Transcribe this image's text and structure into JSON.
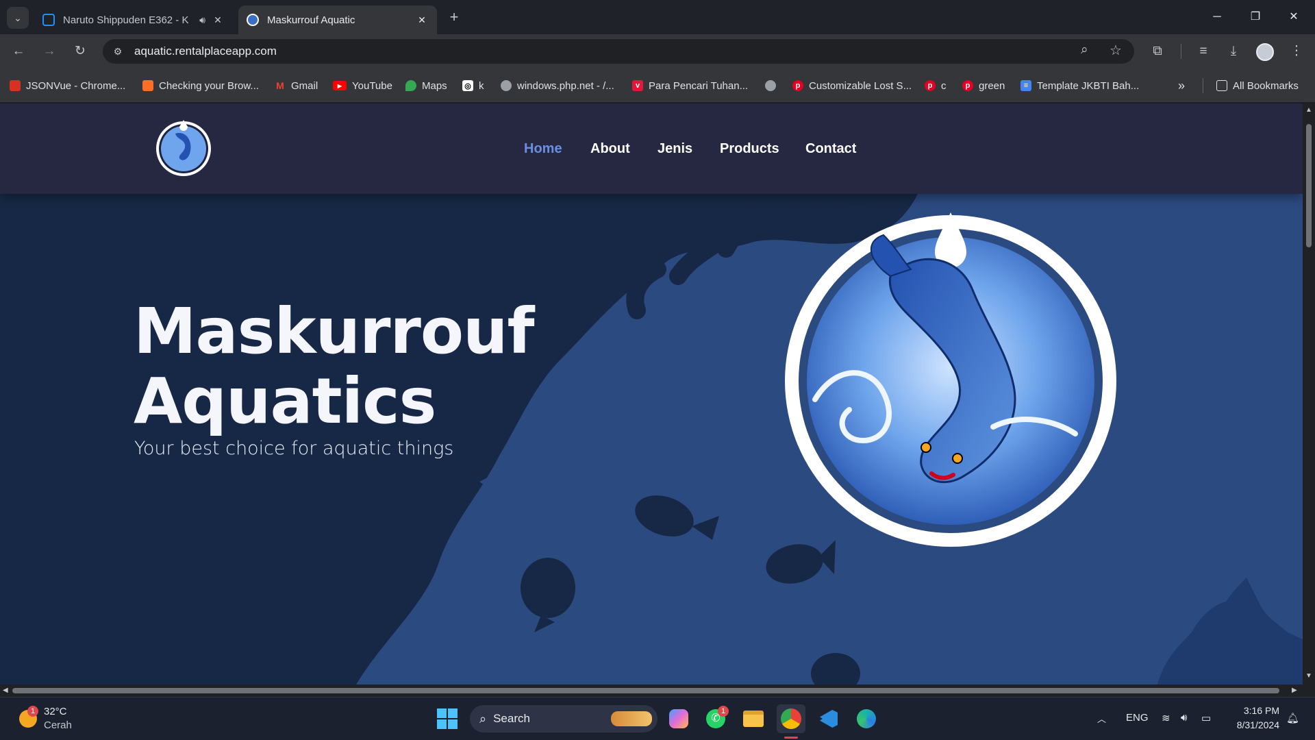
{
  "browser": {
    "tabs": [
      {
        "title": "Naruto Shippuden E362 - K",
        "active": false,
        "favicon_color": "#1e90ff"
      },
      {
        "title": "Maskurrouf Aquatic",
        "active": true,
        "favicon_color": "#3b6fc4"
      }
    ],
    "new_tab_icon": "plus-icon",
    "url": "aquatic.rentalplaceapp.com",
    "bookmarks": [
      {
        "label": "JSONVue - Chrome...",
        "color": "#d93025",
        "icon": "chrome-store-icon"
      },
      {
        "label": "Checking your Brow...",
        "color": "#fc6d26",
        "icon": "gitlab-icon"
      },
      {
        "label": "Gmail",
        "color": "#ea4335",
        "icon": "gmail-icon"
      },
      {
        "label": "YouTube",
        "color": "#ff0000",
        "icon": "youtube-icon"
      },
      {
        "label": "Maps",
        "color": "#34a853",
        "icon": "maps-icon"
      },
      {
        "label": "k",
        "color": "#ffffff",
        "icon": "openai-icon"
      },
      {
        "label": "windows.php.net - /...",
        "color": "#9aa0a6",
        "icon": "globe-icon"
      },
      {
        "label": "Para Pencari Tuhan...",
        "color": "#e4163a",
        "icon": "vidio-icon"
      },
      {
        "label": "",
        "color": "#9aa0a6",
        "icon": "globe-icon"
      },
      {
        "label": "Customizable Lost S...",
        "color": "#e60023",
        "icon": "pinterest-icon"
      },
      {
        "label": "c",
        "color": "#e60023",
        "icon": "pinterest-icon"
      },
      {
        "label": "green",
        "color": "#e60023",
        "icon": "pinterest-icon"
      },
      {
        "label": "Template JKBTI Bah...",
        "color": "#4285f4",
        "icon": "docs-icon"
      }
    ],
    "more_bookmarks": "»",
    "all_bookmarks": "All Bookmarks"
  },
  "site": {
    "nav": [
      {
        "label": "Home",
        "active": true
      },
      {
        "label": "About",
        "active": false
      },
      {
        "label": "Jenis",
        "active": false
      },
      {
        "label": "Products",
        "active": false
      },
      {
        "label": "Contact",
        "active": false
      }
    ],
    "hero": {
      "title_line1": "Maskurrouf",
      "title_line2": "Aquatics",
      "subtitle": "Your best choice for aquatic things"
    },
    "colors": {
      "header_bg": "#252840",
      "hero_bg": "#2b4a80",
      "silhouette": "#172846",
      "nav_active": "#6a8fe0"
    }
  },
  "taskbar": {
    "weather_temp": "32°C",
    "weather_desc": "Cerah",
    "weather_badge": "1",
    "search_label": "Search",
    "whatsapp_badge": "1",
    "lang": "ENG",
    "time": "3:16 PM",
    "date": "8/31/2024"
  }
}
